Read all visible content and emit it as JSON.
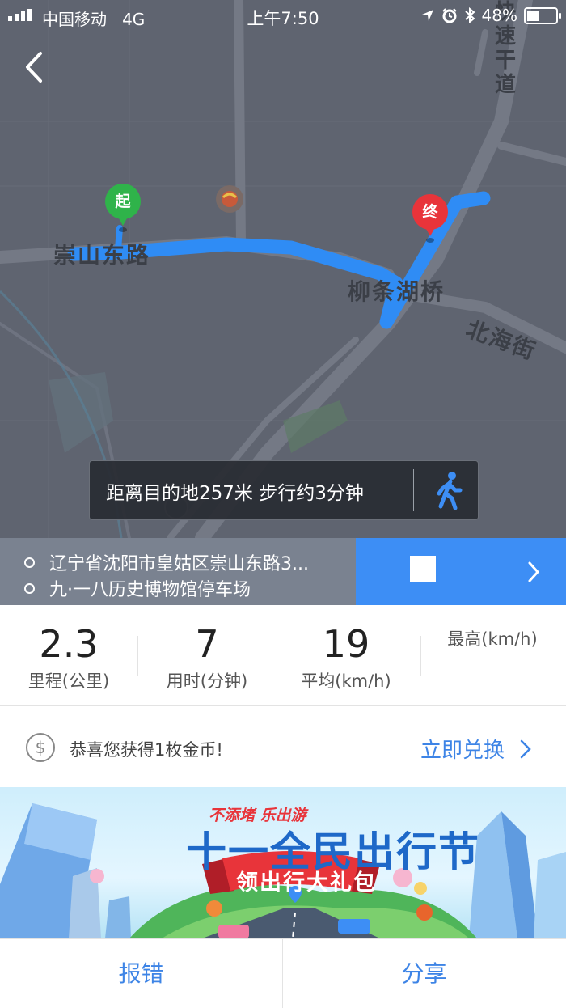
{
  "status_bar": {
    "carrier": "中国移动",
    "network": "4G",
    "time": "上午7:50",
    "battery": "48%",
    "battery_level": 0.48
  },
  "map": {
    "labels": {
      "road_chongshan": "崇山东路",
      "bridge": "柳条湖桥",
      "street_beihai": "北海街",
      "expressway_vertical": "快速干道"
    },
    "start_marker": "起",
    "end_marker": "终",
    "info_box_text": "距离目的地257米 步行约3分钟",
    "route_color": "#2f8cf5"
  },
  "route": {
    "origin": "辽宁省沈阳市皇姑区崇山东路3...",
    "destination": "九·一八历史博物馆停车场"
  },
  "stats": [
    {
      "value": "2.3",
      "label": "里程(公里)"
    },
    {
      "value": "7",
      "label": "用时(分钟)"
    },
    {
      "value": "19",
      "label": "平均(km/h)"
    },
    {
      "value": "",
      "label": "最高(km/h)"
    }
  ],
  "reward": {
    "text": "恭喜您获得1枚金币!",
    "action": "立即兑换"
  },
  "banner": {
    "slogan": "不添堵 乐出游",
    "title": "十一全民出行节",
    "ribbon": "领出行大礼包"
  },
  "bottom_bar": {
    "report": "报错",
    "share": "分享"
  },
  "colors": {
    "accent": "#3d84e6",
    "start_green": "#2fb34a",
    "end_red": "#e8343a"
  }
}
